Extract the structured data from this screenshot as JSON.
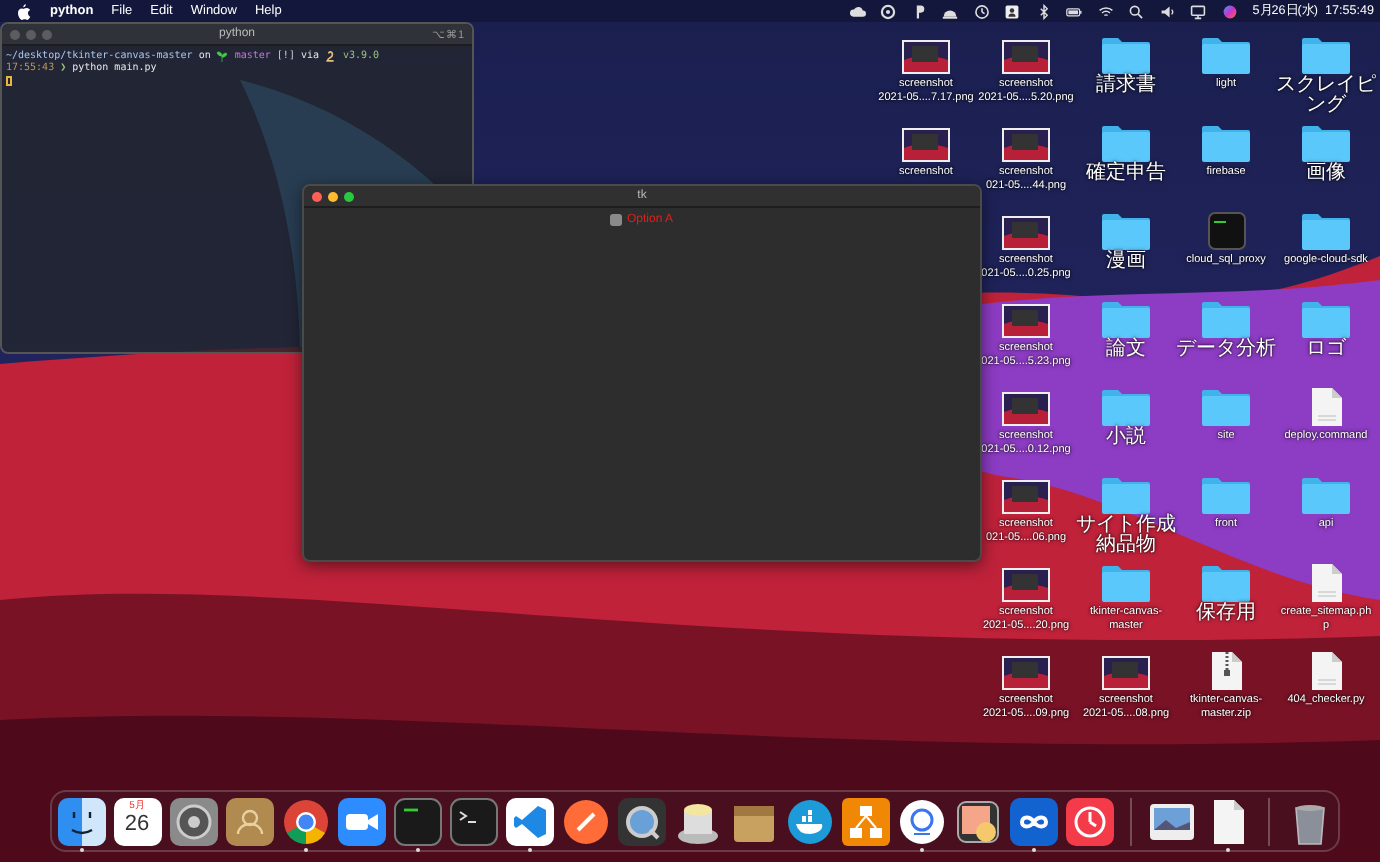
{
  "menu_bar": {
    "app_name": "python",
    "menus": [
      "File",
      "Edit",
      "Window",
      "Help"
    ],
    "clock": "5月26日(水)  17:55:49"
  },
  "terminal": {
    "title": "python",
    "shortcut": "⌥⌘1",
    "path": "~/desktop/tkinter-canvas-master",
    "on_word": "on",
    "branch": "master",
    "git_status": "[!]",
    "via_word": "via",
    "version": "v3.9.0",
    "time": "17:55:43",
    "prompt": "❯",
    "command": "python main.py"
  },
  "tk_window": {
    "title": "tk",
    "checkbox": {
      "label": "Option A",
      "checked": false
    }
  },
  "desktop_columns": [
    {
      "items": [
        {
          "kind": "screenshot",
          "lines": [
            "screenshot",
            "2021-05....7.17.png"
          ]
        },
        {
          "kind": "screenshot",
          "lines": [
            "screenshot"
          ]
        }
      ]
    },
    {
      "items": [
        {
          "kind": "screenshot",
          "lines": [
            "screenshot",
            "2021-05....5.20.png"
          ]
        },
        {
          "kind": "screenshot",
          "lines": [
            "screenshot",
            "021-05....44.png"
          ]
        },
        {
          "kind": "screenshot",
          "lines": [
            "screenshot",
            "021-05....0.25.png"
          ]
        },
        {
          "kind": "screenshot",
          "lines": [
            "screenshot",
            "021-05....5.23.png"
          ]
        },
        {
          "kind": "screenshot",
          "lines": [
            "screenshot",
            "021-05....0.12.png"
          ]
        },
        {
          "kind": "screenshot",
          "lines": [
            "screenshot",
            "021-05....06.png"
          ]
        },
        {
          "kind": "screenshot",
          "lines": [
            "screenshot",
            "2021-05....20.png"
          ]
        },
        {
          "kind": "screenshot",
          "lines": [
            "screenshot",
            "2021-05....09.png"
          ]
        }
      ]
    },
    {
      "items": [
        {
          "kind": "folder",
          "lines": [
            "請求書"
          ]
        },
        {
          "kind": "folder",
          "lines": [
            "確定申告"
          ]
        },
        {
          "kind": "folder",
          "lines": [
            "漫画"
          ]
        },
        {
          "kind": "folder",
          "lines": [
            "論文"
          ]
        },
        {
          "kind": "folder",
          "lines": [
            "小説"
          ]
        },
        {
          "kind": "folder",
          "lines": [
            "サイト作成納品物"
          ]
        },
        {
          "kind": "folder",
          "lines": [
            "tkinter-canvas-",
            "master"
          ]
        },
        {
          "kind": "screenshot",
          "lines": [
            "screenshot",
            "2021-05....08.png"
          ]
        }
      ]
    },
    {
      "items": [
        {
          "kind": "folder",
          "lines": [
            "light"
          ]
        },
        {
          "kind": "folder",
          "lines": [
            "firebase"
          ]
        },
        {
          "kind": "executable",
          "lines": [
            "cloud_sql_proxy"
          ]
        },
        {
          "kind": "folder",
          "lines": [
            "データ分析"
          ]
        },
        {
          "kind": "folder",
          "lines": [
            "site"
          ]
        },
        {
          "kind": "folder",
          "lines": [
            "front"
          ]
        },
        {
          "kind": "folder",
          "lines": [
            "保存用"
          ]
        },
        {
          "kind": "zip",
          "lines": [
            "tkinter-canvas-",
            "master.zip"
          ]
        }
      ]
    },
    {
      "items": [
        {
          "kind": "folder",
          "lines": [
            "スクレイピング"
          ]
        },
        {
          "kind": "folder",
          "lines": [
            "画像"
          ]
        },
        {
          "kind": "folder",
          "lines": [
            "google-cloud-sdk"
          ]
        },
        {
          "kind": "folder",
          "lines": [
            "ロゴ"
          ]
        },
        {
          "kind": "document",
          "lines": [
            "deploy.command"
          ]
        },
        {
          "kind": "folder",
          "lines": [
            "api"
          ]
        },
        {
          "kind": "document",
          "lines": [
            "create_sitemap.ph",
            "p"
          ]
        },
        {
          "kind": "document",
          "lines": [
            "404_checker.py"
          ]
        }
      ]
    }
  ],
  "dock": {
    "apps": [
      {
        "kind": "finder",
        "running": true
      },
      {
        "kind": "calendar",
        "month": "5月",
        "day": "26",
        "running": false
      },
      {
        "kind": "settings",
        "running": false
      },
      {
        "kind": "contacts",
        "running": false
      },
      {
        "kind": "browser",
        "running": true
      },
      {
        "kind": "video",
        "running": false
      },
      {
        "kind": "terminal_alt",
        "running": true
      },
      {
        "kind": "terminal",
        "running": false
      },
      {
        "kind": "code_editor",
        "running": true
      },
      {
        "kind": "rocket",
        "running": false
      },
      {
        "kind": "lens",
        "running": false
      },
      {
        "kind": "database",
        "running": false
      },
      {
        "kind": "archive",
        "running": false
      },
      {
        "kind": "whale",
        "running": false
      },
      {
        "kind": "diagram",
        "running": false
      },
      {
        "kind": "ring",
        "running": true
      },
      {
        "kind": "preview",
        "running": false
      },
      {
        "kind": "infinity",
        "running": true
      },
      {
        "kind": "clock",
        "running": false
      }
    ],
    "documents": [
      {
        "kind": "photo",
        "running": false
      },
      {
        "kind": "document",
        "running": true
      }
    ],
    "trash": {
      "kind": "trash",
      "running": false
    }
  }
}
